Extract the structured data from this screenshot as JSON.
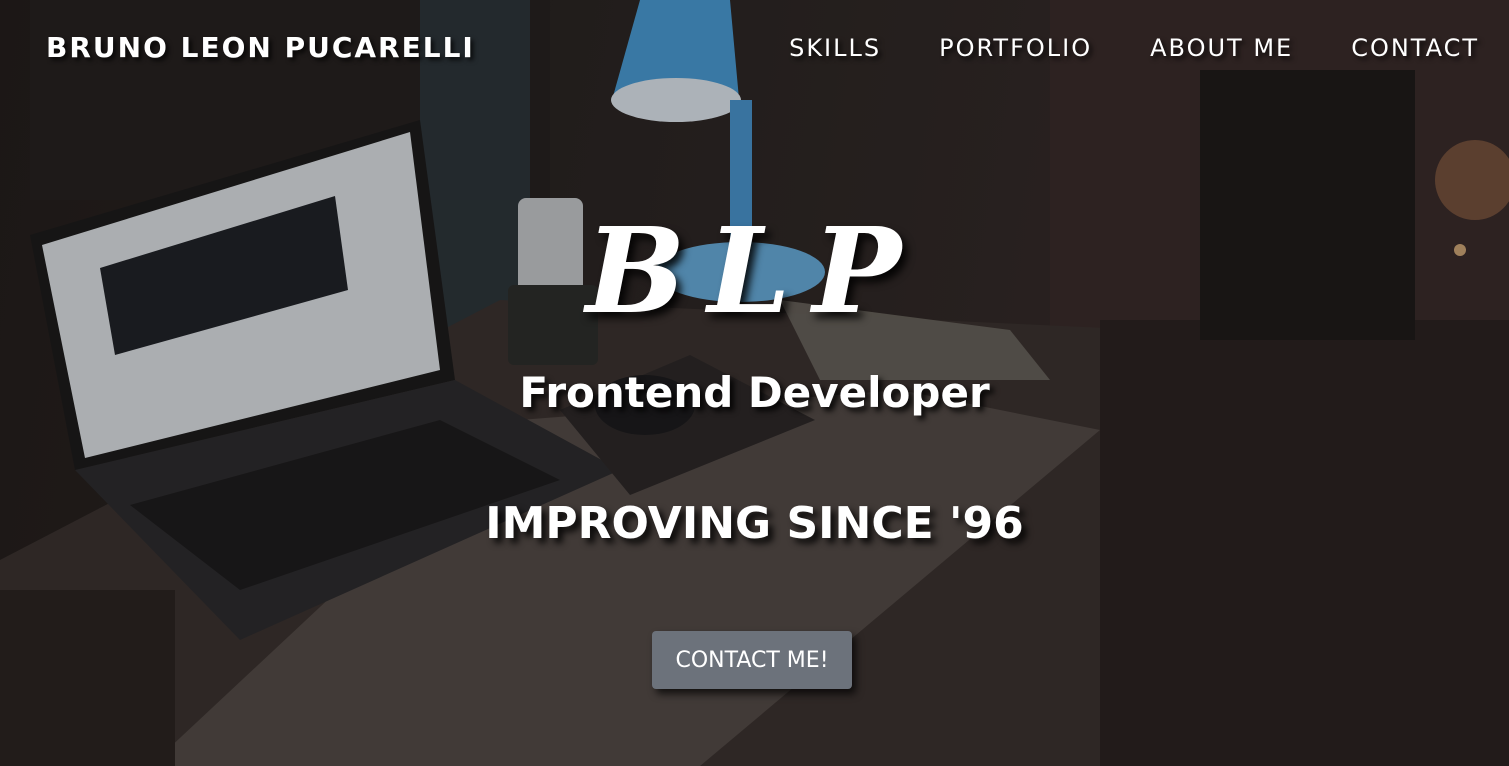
{
  "brand": {
    "name": "BRUNO LEON PUCARELLI"
  },
  "nav": {
    "items": [
      {
        "label": "SKILLS"
      },
      {
        "label": "PORTFOLIO"
      },
      {
        "label": "ABOUT ME"
      },
      {
        "label": "CONTACT"
      }
    ]
  },
  "hero": {
    "monogram": "BLP",
    "role": "Frontend Developer",
    "tagline": "IMPROVING SINCE '96",
    "cta_label": "CONTACT ME!"
  },
  "colors": {
    "text": "#ffffff",
    "button_bg": "#6c727b",
    "background_dark": "#1a1614"
  }
}
